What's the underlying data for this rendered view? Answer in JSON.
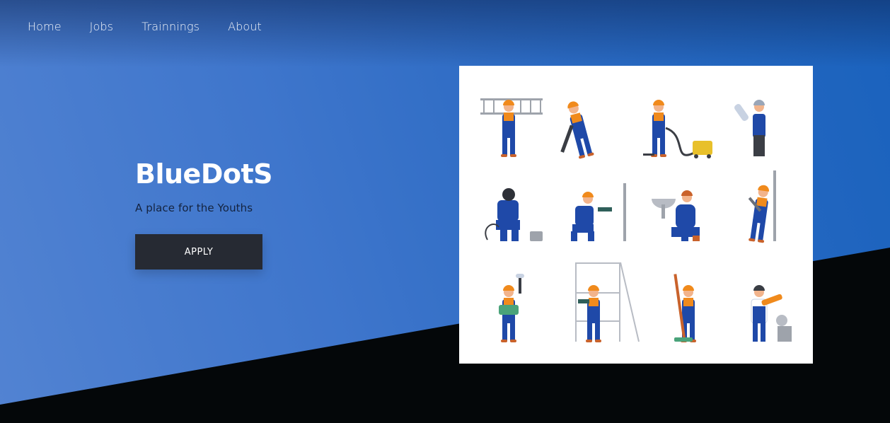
{
  "nav": {
    "items": [
      {
        "label": "Home"
      },
      {
        "label": "Jobs"
      },
      {
        "label": "Trainnings"
      },
      {
        "label": "About"
      }
    ]
  },
  "hero": {
    "title": "BlueDotS",
    "tagline": "A place for the Youths",
    "apply_label": "APPLY"
  },
  "colors": {
    "hero_blue": "#3f76cc",
    "dark_band": "#040709",
    "button_bg": "#262a33",
    "worker_blue": "#1f49a8",
    "worker_orange": "#f08a1c"
  },
  "illustration": {
    "workers": [
      "ladder-carrier",
      "jackhammer-worker",
      "vacuum-cleaner-worker",
      "blueprint-holder",
      "welder",
      "drill-on-wall-worker",
      "plumber-sink",
      "wall-installer",
      "painter-roller",
      "scaffold-driller",
      "broom-sweeper",
      "chainsaw-worker"
    ]
  }
}
